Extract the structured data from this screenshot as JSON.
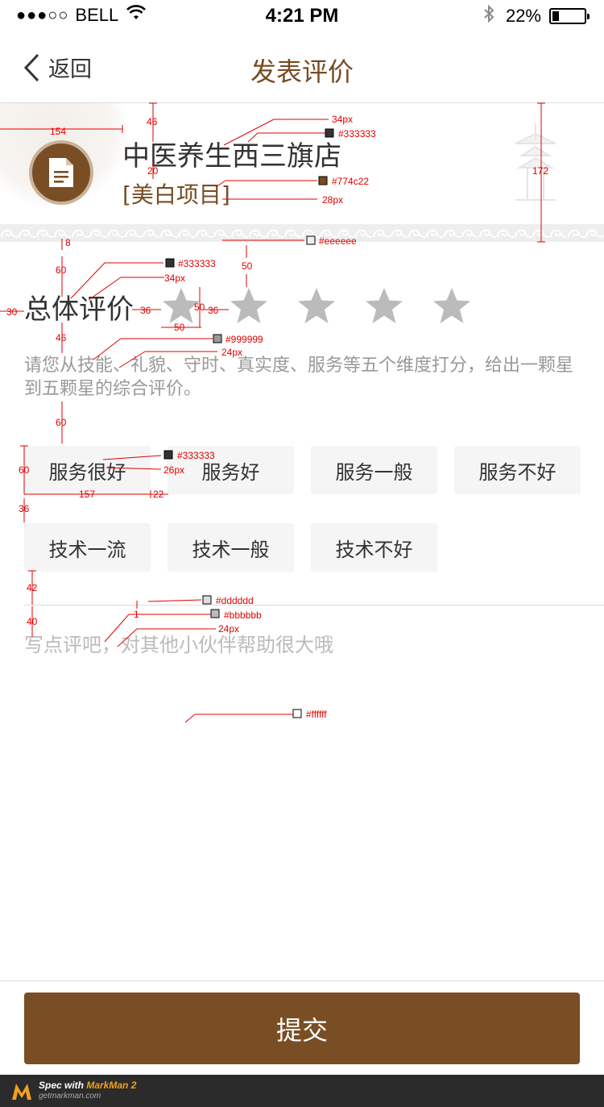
{
  "status_bar": {
    "carrier": "BELL",
    "time": "4:21 PM",
    "battery_percent": "22%",
    "battery_level": 0.22,
    "icons": [
      "signal-dots-icon",
      "wifi-icon",
      "bluetooth-icon",
      "battery-icon"
    ]
  },
  "nav": {
    "back_label": "返回",
    "title": "发表评价",
    "icons": [
      "chevron-left-icon"
    ]
  },
  "shop": {
    "name": "中医养生西三旗店",
    "service": "[美白项目]",
    "icons": [
      "document-icon"
    ]
  },
  "rating": {
    "label": "总体评价",
    "star_count": 5,
    "selected": 0,
    "hint": "请您从技能、礼貌、守时、真实度、服务等五个维度打分，给出一颗星到五颗星的综合评价。",
    "icons": [
      "star-icon"
    ]
  },
  "tags": [
    {
      "label": "服务很好"
    },
    {
      "label": "服务好"
    },
    {
      "label": "服务一般"
    },
    {
      "label": "服务不好"
    },
    {
      "label": "技术一流"
    },
    {
      "label": "技术一般"
    },
    {
      "label": "技术不好"
    }
  ],
  "comment": {
    "placeholder": "写点评吧，对其他小伙伴帮助很大哦"
  },
  "submit": {
    "label": "提交"
  },
  "footer": {
    "line1_prefix": "Spec with ",
    "line1_brand": "MarkMan 2",
    "line2": "getmarkman.com",
    "icons": [
      "markman-logo-icon"
    ]
  },
  "annotations": {
    "m_154": "154",
    "m_46_top": "46",
    "m_20": "20",
    "m_172": "172",
    "c_name_size": "34px",
    "c_name_color": "#333333",
    "c_service_color": "#774c22",
    "c_service_size": "28px",
    "c_border_color": "#eeeeee",
    "m_8": "8",
    "m_60_a": "60",
    "m_50_v": "50",
    "c_label_color": "#333333",
    "c_label_size": "34px",
    "m_30": "30",
    "m_36_a": "36",
    "m_50_star_h": "50",
    "m_36_b": "36",
    "m_50_star_w": "50",
    "m_46_b": "46",
    "c_hint_color": "#999999",
    "c_hint_size": "24px",
    "m_60_b": "60",
    "m_60_tag_h": "60",
    "c_tag_color": "#333333",
    "c_tag_size": "26px",
    "m_157": "157",
    "m_22": "22",
    "m_36_c": "36",
    "m_42": "42",
    "c_divider_color": "#dddddd",
    "m_1": "1",
    "c_placeholder_color": "#bbbbbb",
    "m_40": "40",
    "c_placeholder_size": "24px",
    "c_bg_color": "#ffffff"
  },
  "colors": {
    "brand_brown": "#774c22",
    "button_brown": "#7a4e24",
    "text_dark": "#333333",
    "text_gray": "#999999",
    "placeholder": "#bbbbbb",
    "star_gray": "#bbbbbb",
    "tag_bg": "#f5f5f5",
    "divider": "#dddddd",
    "spec_red": "#e00000"
  }
}
